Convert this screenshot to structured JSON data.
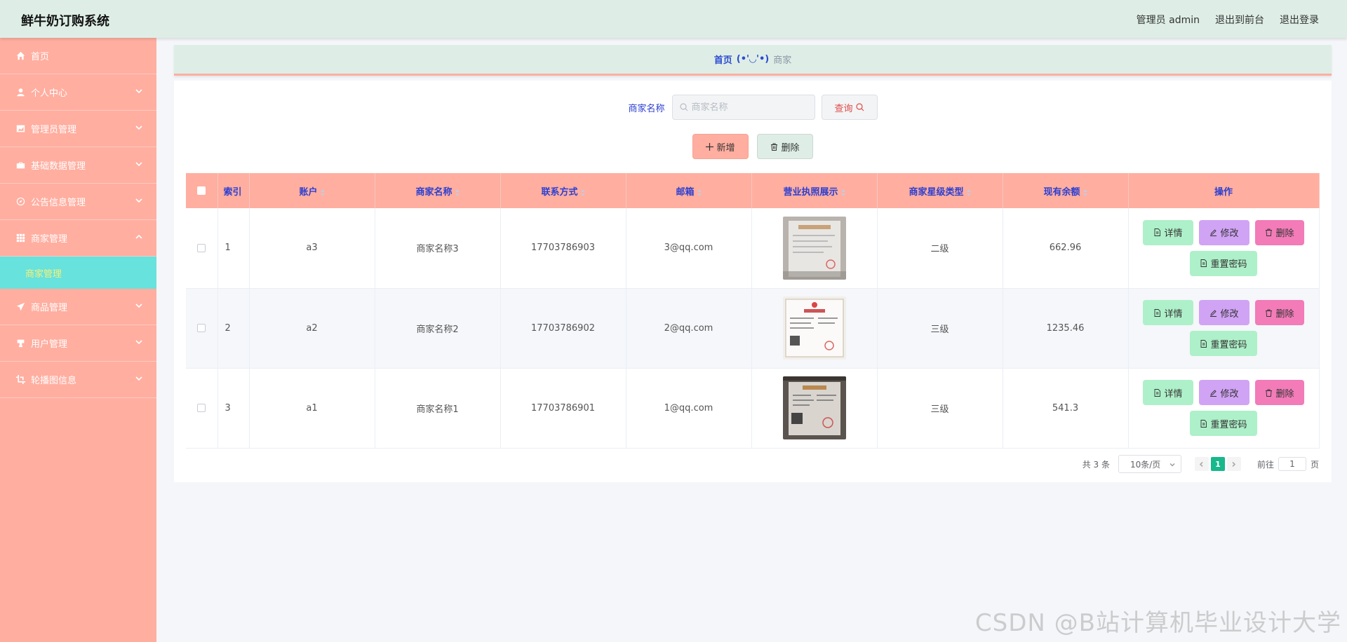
{
  "header": {
    "title": "鲜牛奶订购系统",
    "user": "管理员 admin",
    "to_front": "退出到前台",
    "logout": "退出登录"
  },
  "sidebar": {
    "items": [
      {
        "label": "首页",
        "icon": "home-icon",
        "has_children": false
      },
      {
        "label": "个人中心",
        "icon": "user-icon",
        "has_children": true
      },
      {
        "label": "管理员管理",
        "icon": "chart-icon",
        "has_children": true
      },
      {
        "label": "基础数据管理",
        "icon": "briefcase-icon",
        "has_children": true
      },
      {
        "label": "公告信息管理",
        "icon": "compass-icon",
        "has_children": true
      },
      {
        "label": "商家管理",
        "icon": "grid-icon",
        "has_children": true,
        "expanded": true
      },
      {
        "label": "商品管理",
        "icon": "send-icon",
        "has_children": true
      },
      {
        "label": "用户管理",
        "icon": "stamp-icon",
        "has_children": true
      },
      {
        "label": "轮播图信息",
        "icon": "crop-icon",
        "has_children": true
      }
    ],
    "active_sub": "商家管理"
  },
  "breadcrumb": {
    "home": "首页",
    "emoji": "(•'◡'•)",
    "current": "商家"
  },
  "search": {
    "label": "商家名称",
    "placeholder": "商家名称",
    "query_button": "查询"
  },
  "actions": {
    "add": "新增",
    "delete": "删除"
  },
  "table": {
    "columns": [
      "索引",
      "账户",
      "商家名称",
      "联系方式",
      "邮箱",
      "营业执照展示",
      "商家星级类型",
      "现有余额",
      "操作"
    ],
    "rows": [
      {
        "index": "1",
        "account": "a3",
        "name": "商家名称3",
        "phone": "17703786903",
        "email": "3@qq.com",
        "level": "二级",
        "balance": "662.96"
      },
      {
        "index": "2",
        "account": "a2",
        "name": "商家名称2",
        "phone": "17703786902",
        "email": "2@qq.com",
        "level": "三级",
        "balance": "1235.46"
      },
      {
        "index": "3",
        "account": "a1",
        "name": "商家名称1",
        "phone": "17703786901",
        "email": "1@qq.com",
        "level": "三级",
        "balance": "541.3"
      }
    ],
    "ops": {
      "detail": "详情",
      "edit": "修改",
      "remove": "删除",
      "reset": "重置密码"
    }
  },
  "pagination": {
    "total": "共 3 条",
    "page_size": "10条/页",
    "current": "1",
    "goto_label": "前往",
    "goto_value": "1",
    "page_unit": "页"
  },
  "watermark": "CSDN @B站计算机毕业设计大学",
  "colors": {
    "header_bg": "#deeee6",
    "sidebar_bg": "#ffaea0",
    "submenu_active": "#67e2dc",
    "accent_blue": "#2b3fd0",
    "page_active": "#17b88b"
  }
}
